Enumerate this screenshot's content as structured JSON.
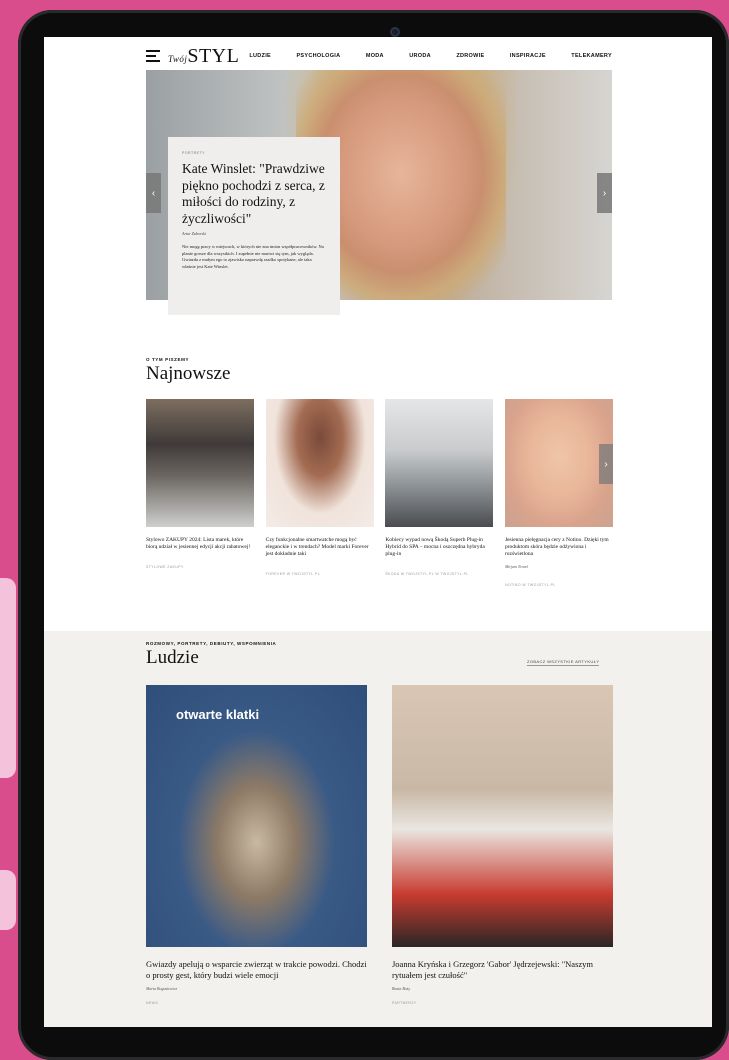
{
  "nav": {
    "logo_prefix": "Twój",
    "logo": "STYL",
    "items": [
      "LUDZIE",
      "PSYCHOLOGIA",
      "MODA",
      "URODA",
      "ZDROWIE",
      "INSPIRACJE",
      "TELEKAMERY"
    ]
  },
  "hero": {
    "kicker": "PORTRETY",
    "title": "Kate Winslet: \"Prawdziwe piękno pochodzi z serca, z miłości do rodziny, z życzliwości\"",
    "author": "Artur Zaborski",
    "lead": "Nie mogę pracy w miejscach, w których nie zna imion współpracowników. Na planie gorsze dla wszystkich. I zupełnie nie martwi się tym, jak wygląda. Gwiazda z małym ego to zjawisko naprawdę rzadko spotykane, ale taka właśnie jest Kate Winslet.",
    "arrow_left": "‹",
    "arrow_right": "›"
  },
  "newest": {
    "kicker": "O TYM PISZEMY",
    "title": "Najnowsze",
    "arrow": "›",
    "cards": [
      {
        "title": "Stylowo ZAKUPY 2024: Lista marek, które biorą udział w jesiennej edycji akcji rabatowej!",
        "author": "",
        "tag": "STYLOWE ZAKUPY"
      },
      {
        "title": "Czy funkcjonalne smartwatche mogą być eleganckie i w trendach? Model marki Forever jest dokładnie taki",
        "author": "",
        "tag": "FOREVER W TWOJSTYL.PL"
      },
      {
        "title": "Kobiecy wypad nową Škodą Superb Plug-in Hybrid do SPA – mocna i oszczędna hybryda plug-in",
        "author": "",
        "tag": "ŠKODA W TWOJSTYL.PL W TWOJSTYL.PL"
      },
      {
        "title": "Jesienna pielęgnacja cery z Notino. Dzięki tym produktom skóra będzie odżywiona i rozświetlona",
        "author": "Mirjam Nowel",
        "tag": "NOTINO W TWOJSTYL.PL"
      }
    ]
  },
  "people": {
    "kicker": "ROZMOWY, PORTRETY, DEBIUTY, WSPOMNIENIA",
    "title": "Ludzie",
    "see_all": "ZOBACZ WSZYSTKIE ARTYKUŁY",
    "photo_text": "otwarte klatki",
    "cards": [
      {
        "title": "Gwiazdy apelują o wsparcie zwierząt w trakcie powodzi. Chodzi o prosty gest, który budzi wiele emocji",
        "author": "Marta Bogusiewicz",
        "tag": "NEWS"
      },
      {
        "title": "Joanna Kryńska i Grzegorz 'Gabor' Jędrzejewski: \"Naszym rytuałem jest czułość\"",
        "author": "Beata Boży",
        "tag": "PARTNERZY"
      }
    ]
  }
}
